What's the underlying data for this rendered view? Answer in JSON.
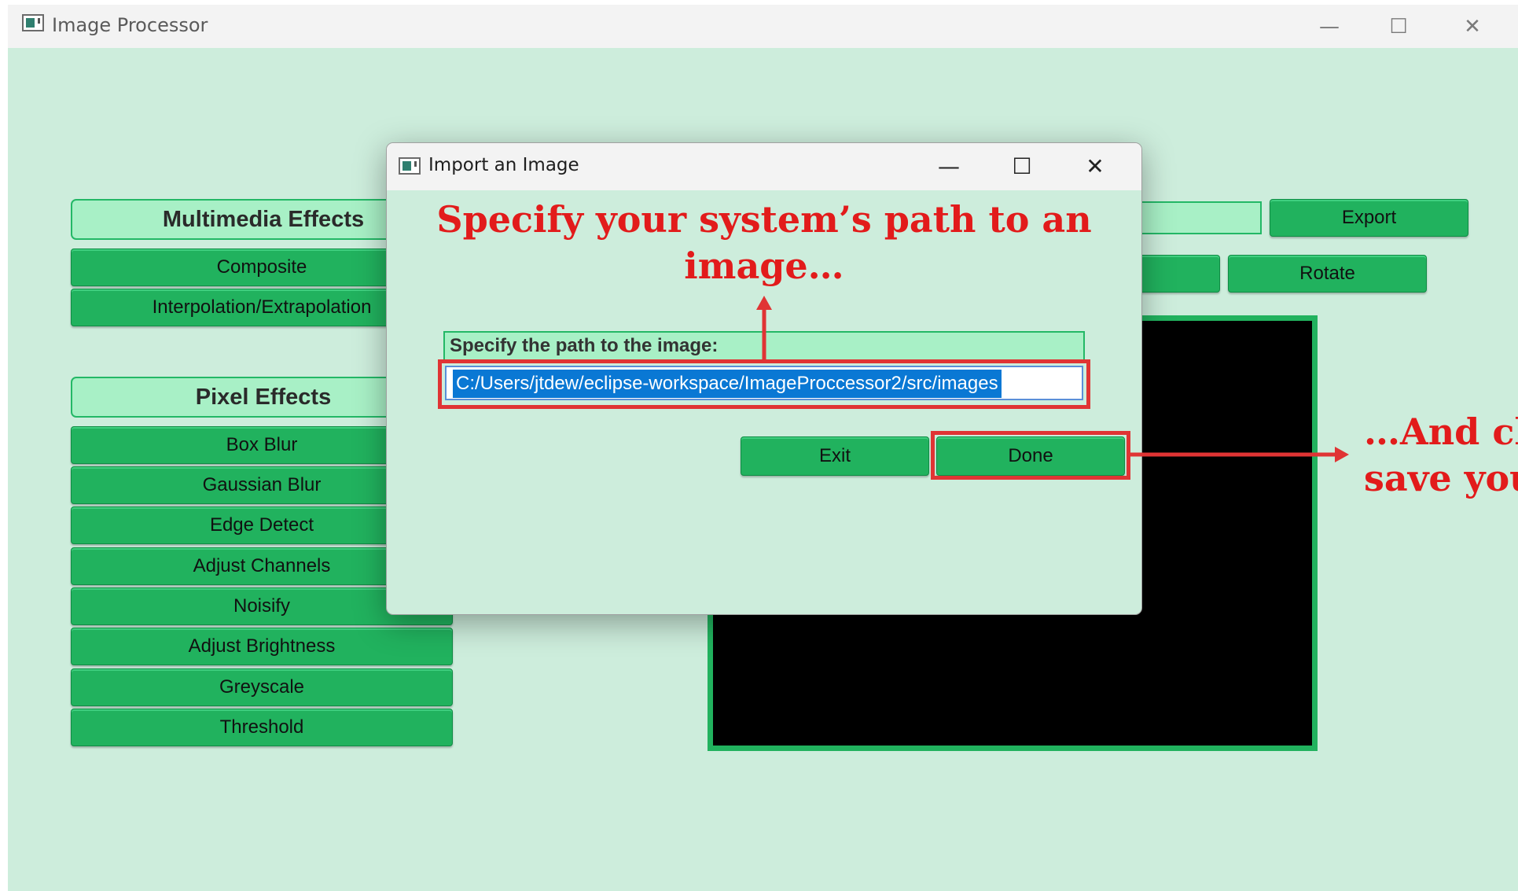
{
  "main_window": {
    "title": "Image Processor",
    "controls": {
      "minimize": "—",
      "maximize": "☐",
      "close": "✕"
    }
  },
  "left_panel": {
    "multimedia_header": "Multimedia Effects",
    "multimedia_buttons": [
      "Composite",
      "Interpolation/Extrapolation"
    ],
    "pixel_header": "Pixel Effects",
    "pixel_buttons": [
      "Box Blur",
      "Gaussian Blur",
      "Edge Detect",
      "Adjust Channels",
      "Noisify",
      "Adjust Brightness",
      "Greyscale",
      "Threshold"
    ]
  },
  "top_right": {
    "export_label": "Export",
    "rotate_label": "Rotate"
  },
  "dialog": {
    "title": "Import an Image",
    "controls": {
      "minimize": "—",
      "maximize": "☐",
      "close": "✕"
    },
    "path_label": "Specify the path to the image:",
    "path_value": "C:/Users/jtdew/eclipse-workspace/ImageProccessor2/src/images",
    "exit_label": "Exit",
    "done_label": "Done"
  },
  "annotations": {
    "top_line1": "Specify your system’s path to an",
    "top_line2": "image…",
    "right_line1": "…And cl",
    "right_line2": "save you",
    "color": "#e03434"
  }
}
